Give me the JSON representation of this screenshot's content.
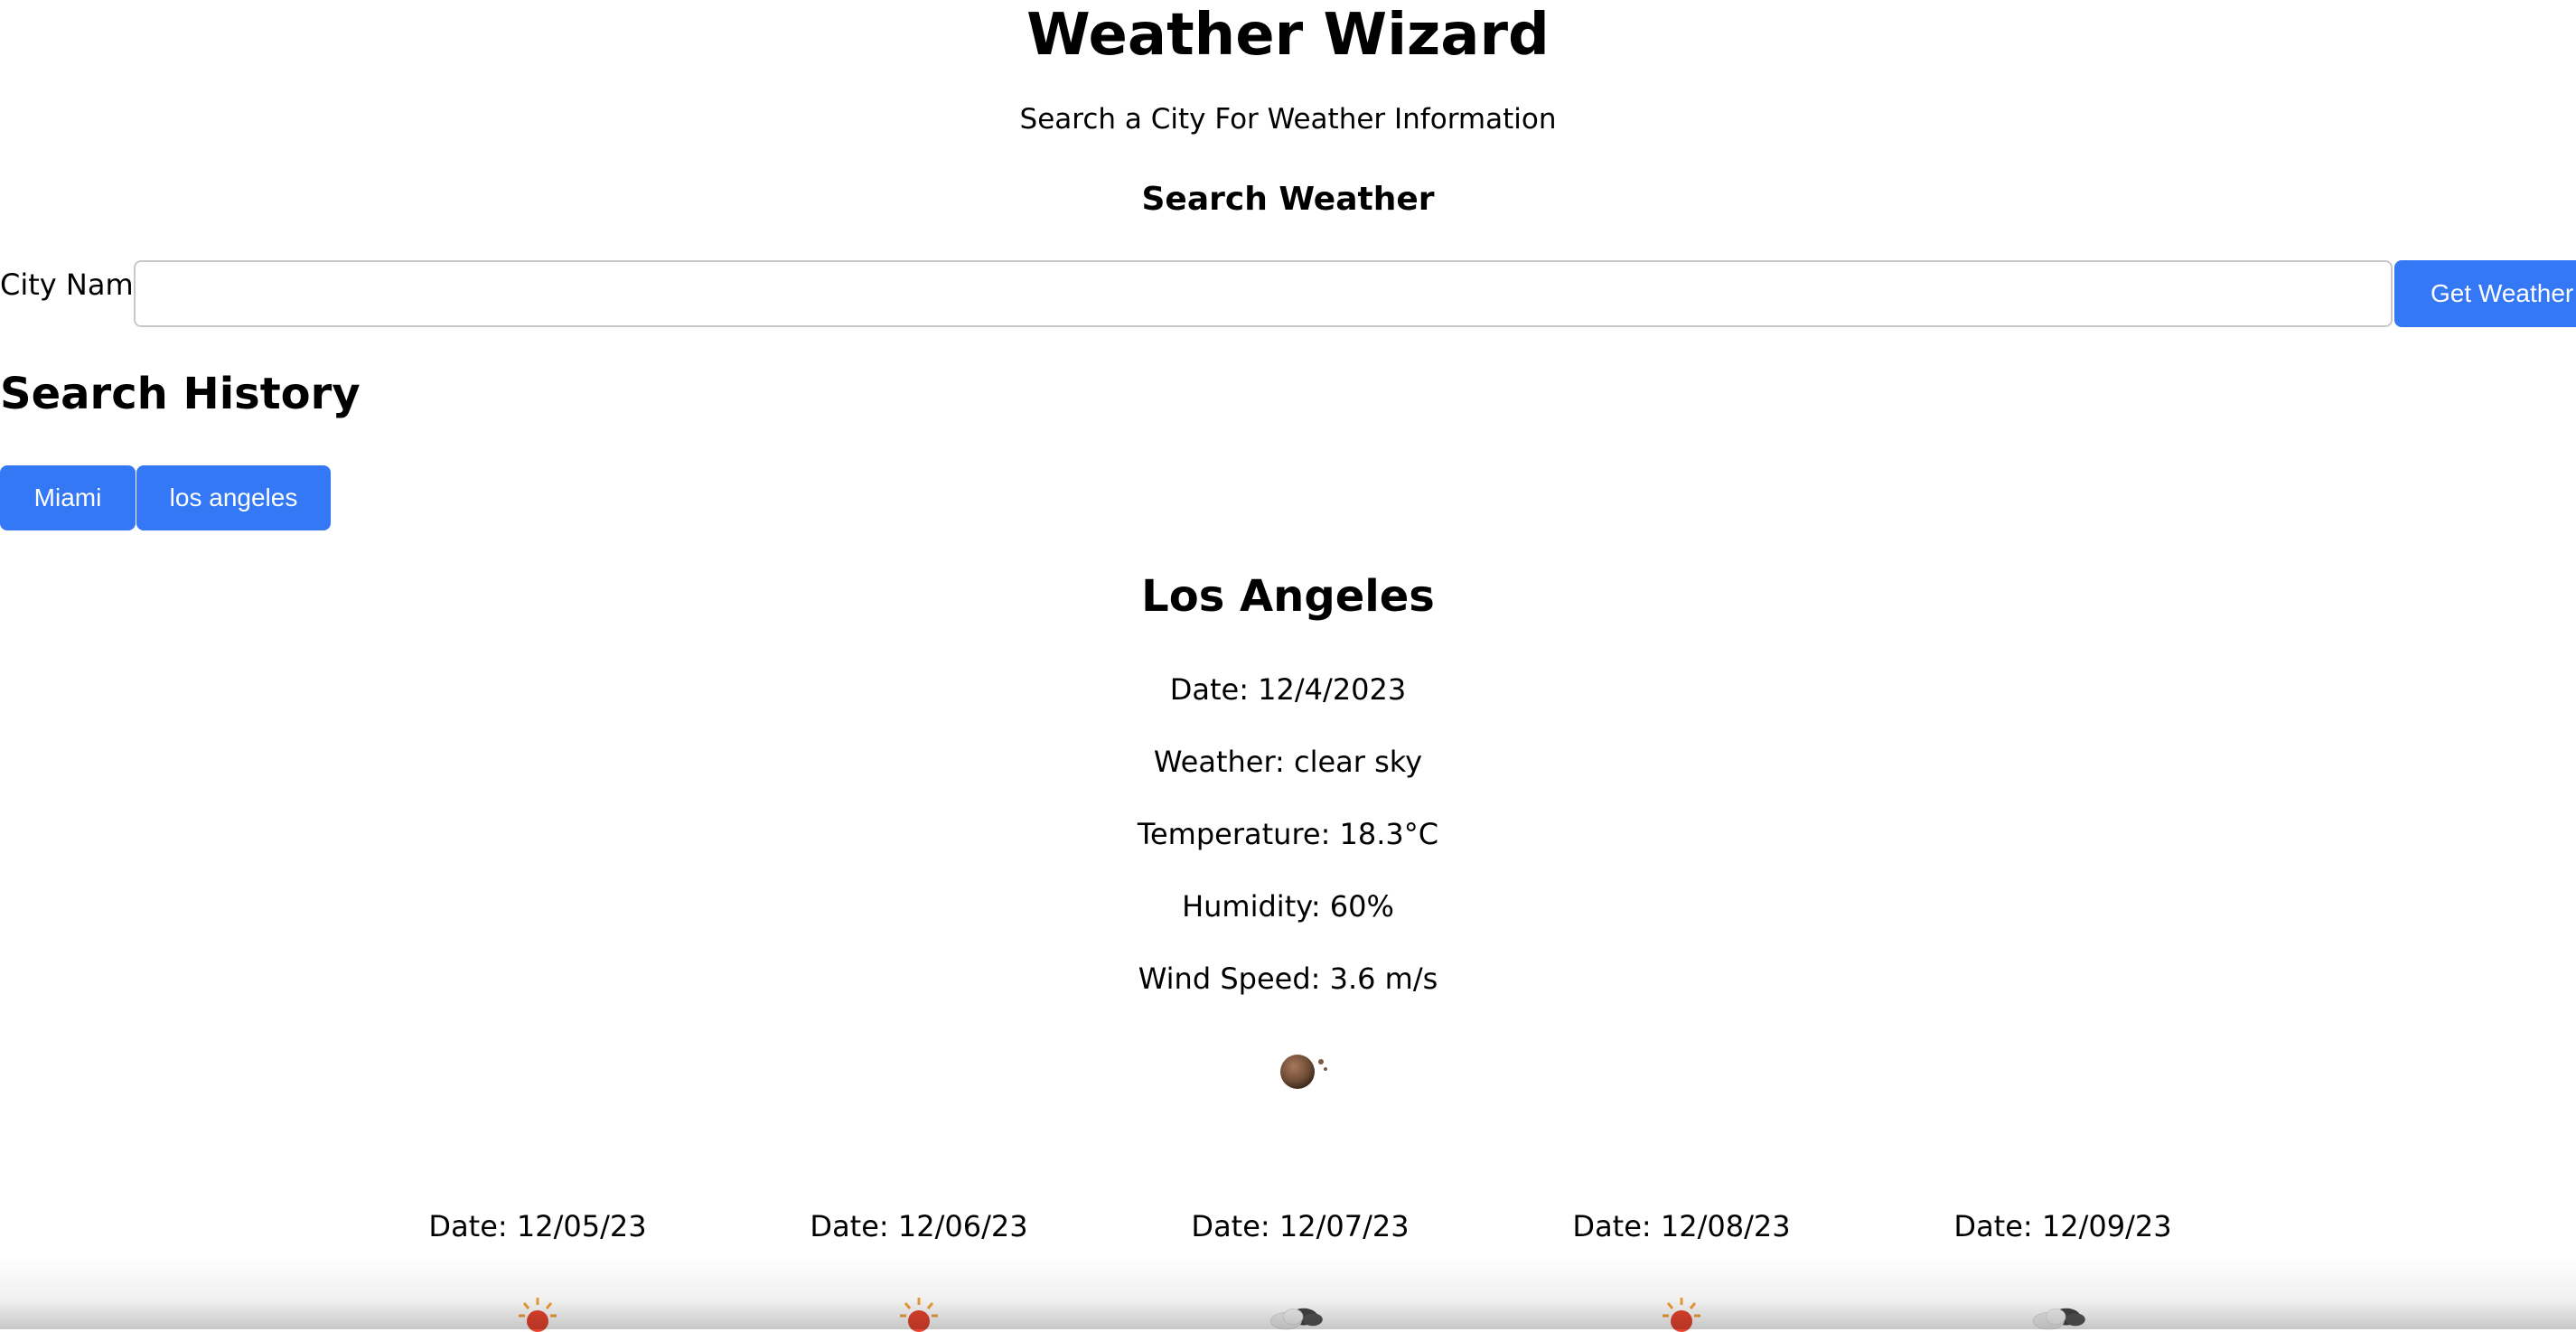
{
  "header": {
    "title": "Weather Wizard",
    "subtitle": "Search a City For Weather Information"
  },
  "search": {
    "heading": "Search Weather",
    "label": "City Name",
    "input_value": "",
    "placeholder": "",
    "button_label": "Get Weather"
  },
  "history": {
    "heading": "Search History",
    "items": [
      {
        "label": "Miami"
      },
      {
        "label": "los angeles"
      }
    ]
  },
  "current": {
    "city": "Los Angeles",
    "date": "Date: 12/4/2023",
    "weather": "Weather: clear sky",
    "temperature": "Temperature: 18.3°C",
    "humidity": "Humidity: 60%",
    "wind": "Wind Speed: 3.6 m/s",
    "icon": "clear-sky-night-icon"
  },
  "forecast": [
    {
      "date": "Date: 12/05/23",
      "icon": "sun-icon"
    },
    {
      "date": "Date: 12/06/23",
      "icon": "sun-icon"
    },
    {
      "date": "Date: 12/07/23",
      "icon": "cloud-icon"
    },
    {
      "date": "Date: 12/08/23",
      "icon": "sun-icon"
    },
    {
      "date": "Date: 12/09/23",
      "icon": "cloud-icon"
    }
  ],
  "colors": {
    "button_bg": "#3478f6",
    "button_text": "#ffffff"
  }
}
